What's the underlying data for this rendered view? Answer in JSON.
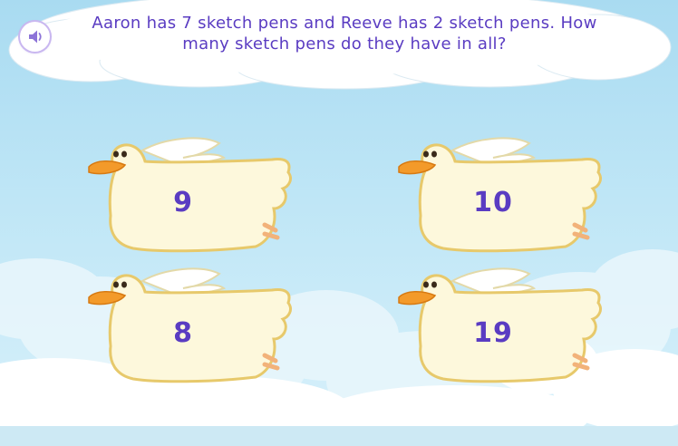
{
  "question": {
    "line1": "Aaron has 7 sketch pens and Reeve has 2 sketch pens. How",
    "line2": "many sketch pens do they have in all?"
  },
  "audio_icon": "speaker-icon",
  "answers": [
    {
      "label": "9"
    },
    {
      "label": "10"
    },
    {
      "label": "8"
    },
    {
      "label": "19"
    }
  ],
  "colors": {
    "question_text": "#5a3cc2",
    "number_text": "#5a3cc2",
    "bird_body": "#fdf8dc",
    "bird_outline": "#e7c96b",
    "beak": "#f39a2a",
    "sky": "#bfe6f6"
  }
}
